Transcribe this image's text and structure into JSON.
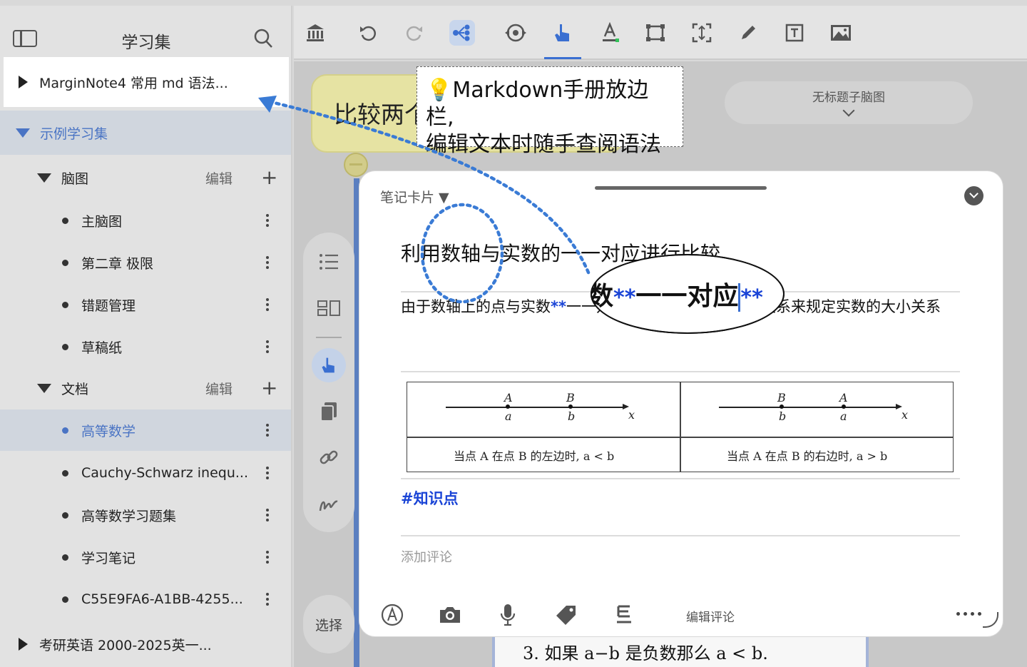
{
  "sidebar": {
    "title": "学习集",
    "items": [
      {
        "label": "MarginNote4 常用 md 语法..."
      },
      {
        "label": "示例学习集"
      },
      {
        "label": "脑图",
        "edit": "编辑",
        "add": "+"
      },
      {
        "label": "主脑图"
      },
      {
        "label": "第二章 极限"
      },
      {
        "label": "错题管理"
      },
      {
        "label": "草稿纸"
      },
      {
        "label": "文档",
        "edit": "编辑",
        "add": "+"
      },
      {
        "label": "高等数学"
      },
      {
        "label": "Cauchy-Schwarz inequ..."
      },
      {
        "label": "高等数学习题集"
      },
      {
        "label": "学习笔记"
      },
      {
        "label": "C55E9FA6-A1BB-4255..."
      },
      {
        "label": "考研英语 2000-2025英一..."
      }
    ],
    "more_glyph": "⋮"
  },
  "toolbar": {
    "icons": [
      "library-icon",
      "undo-icon",
      "redo-icon",
      "mindmap-icon",
      "sync-icon",
      "hand-pointer-icon",
      "text-color-icon",
      "select-rect-icon",
      "expand-icon",
      "pencil-icon",
      "textbox-icon",
      "image-icon"
    ],
    "active_index": 5
  },
  "canvas": {
    "mind_node_text": "比较两个",
    "untitled_map": "无标题子脑图",
    "doc_text": "3.  如果 a−b 是负数那么 a < b."
  },
  "side_tools": {
    "select_label": "选择",
    "icons": [
      "list-icon",
      "layout-icon",
      "hand-pointer-icon",
      "copy-icon",
      "link-icon",
      "scribble-icon"
    ]
  },
  "note_card": {
    "label": "笔记卡片 ▼",
    "title": "利用数轴与实数的一一对应进行比较",
    "body_before": "由于数轴上的点与实数",
    "body_star": "**",
    "body_after": "一一对应**，数轴上点的位置关系来规定实数的大小关系",
    "table": {
      "left": {
        "points": [
          {
            "upper": "A",
            "lower": "a"
          },
          {
            "upper": "B",
            "lower": "b"
          }
        ],
        "axis": "x",
        "caption": "当点 A 在点 B 的左边时, a < b"
      },
      "right": {
        "points": [
          {
            "upper": "B",
            "lower": "b"
          },
          {
            "upper": "A",
            "lower": "a"
          }
        ],
        "axis": "x",
        "caption": "当点 A 在点 B 的右边时, a > b"
      }
    },
    "tag": "#知识点",
    "comment_placeholder": "添加评论",
    "bottom_icons": [
      "pen-circle-icon",
      "camera-icon",
      "microphone-icon",
      "tag-icon",
      "format-icon"
    ],
    "edit_comment": "编辑评论"
  },
  "annotations": {
    "tip_line1": "💡Markdown手册放边栏,",
    "tip_line2": "编辑文本时随手查阅语法",
    "magnifier_prefix": "数",
    "magnifier_star_left": "**",
    "magnifier_main": "一一对应",
    "magnifier_star_right": "**"
  },
  "colors": {
    "accent": "#3a6fd1",
    "markdown_blue": "#1a44d6",
    "node_yellow": "#e6e3a3",
    "sidebar_selected_text": "#4a74c4"
  }
}
